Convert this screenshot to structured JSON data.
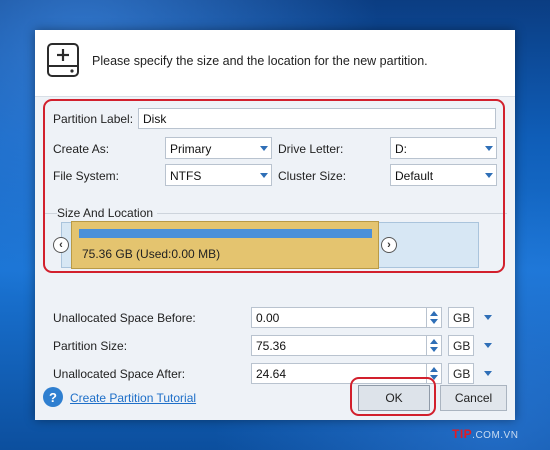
{
  "dialog": {
    "description": "Please specify the size and the location for the new partition.",
    "icon": "add-disk-icon"
  },
  "form": {
    "partition_label": {
      "label": "Partition Label:",
      "value": "Disk"
    },
    "create_as": {
      "label": "Create As:",
      "value": "Primary"
    },
    "drive_letter": {
      "label": "Drive Letter:",
      "value": "D:"
    },
    "file_system": {
      "label": "File System:",
      "value": "NTFS"
    },
    "cluster_size": {
      "label": "Cluster Size:",
      "value": "Default"
    }
  },
  "size_location": {
    "title": "Size And Location",
    "partition_text": "75.36 GB (Used:0.00 MB)",
    "partition_fraction": 0.754
  },
  "sizes": {
    "before": {
      "label": "Unallocated Space Before:",
      "value": "0.00",
      "unit": "GB"
    },
    "size": {
      "label": "Partition Size:",
      "value": "75.36",
      "unit": "GB"
    },
    "after": {
      "label": "Unallocated Space After:",
      "value": "24.64",
      "unit": "GB"
    }
  },
  "footer": {
    "tutorial_link": "Create Partition Tutorial",
    "ok_label": "OK",
    "cancel_label": "Cancel"
  },
  "watermark": {
    "brand": "TIP",
    "suffix": ".COM.VN"
  },
  "colors": {
    "highlight": "#d2202d",
    "partition": "#e4c46f",
    "partition_bar": "#4a90d9",
    "link": "#1e6fc8"
  }
}
